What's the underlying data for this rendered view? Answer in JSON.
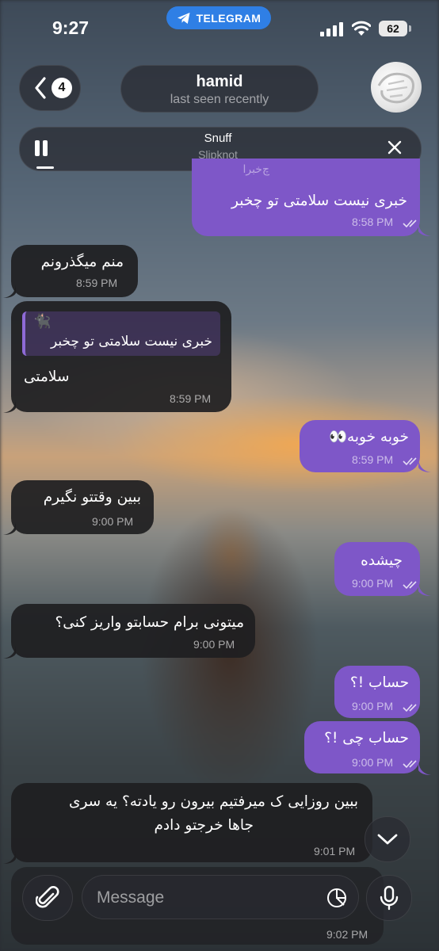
{
  "status_bar": {
    "time": "9:27",
    "app_pill": "TELEGRAM",
    "battery": "62"
  },
  "header": {
    "back_count": "4",
    "name": "hamid",
    "status": "last seen recently"
  },
  "player": {
    "title": "Snuff",
    "artist": "Slipknot"
  },
  "messages": [
    {
      "dir": "out",
      "text": "خبری نیست سلامتی تو چخبر",
      "time": "8:58 PM",
      "read": true,
      "quote_snippet": "چ‌خبرا"
    },
    {
      "dir": "in",
      "text": "منم میگذرونم",
      "time": "8:59 PM"
    },
    {
      "dir": "in",
      "text": "سلامتی",
      "time": "8:59 PM",
      "reply": {
        "emoji": "🐈‍⬛",
        "text": "خبری نیست سلامتی تو چخبر"
      }
    },
    {
      "dir": "out",
      "text": "خوبه خوبه👀",
      "time": "8:59 PM",
      "read": true
    },
    {
      "dir": "in",
      "text": "ببین وقتتو نگیرم",
      "time": "9:00 PM"
    },
    {
      "dir": "out",
      "text": "چیشده",
      "time": "9:00 PM",
      "read": true
    },
    {
      "dir": "in",
      "text": "میتونی برام حسابتو واریز کنی؟",
      "time": "9:00 PM"
    },
    {
      "dir": "out",
      "text": "حساب !؟",
      "time": "9:00 PM",
      "read": true
    },
    {
      "dir": "out",
      "text": "حساب چی !؟",
      "time": "9:00 PM",
      "read": true
    },
    {
      "dir": "in",
      "lines": [
        "ببین روزایی ک میرفتیم بیرون رو یادته؟ یه سری",
        "جاها خرجتو دادم"
      ],
      "time": "9:01 PM"
    },
    {
      "dir": "in",
      "time": "9:02 PM"
    }
  ],
  "composer": {
    "placeholder": "Message"
  },
  "icons": [
    "telegram-icon",
    "signal-icon",
    "wifi-icon",
    "chevron-left-icon",
    "pause-icon",
    "close-icon",
    "double-check-icon",
    "chevron-down-icon",
    "paperclip-icon",
    "sticker-icon",
    "microphone-icon"
  ],
  "colors": {
    "outgoing_bubble": "#7e57c8",
    "incoming_bubble": "#1e1e21",
    "telegram_pill": "#2f7fe5"
  }
}
